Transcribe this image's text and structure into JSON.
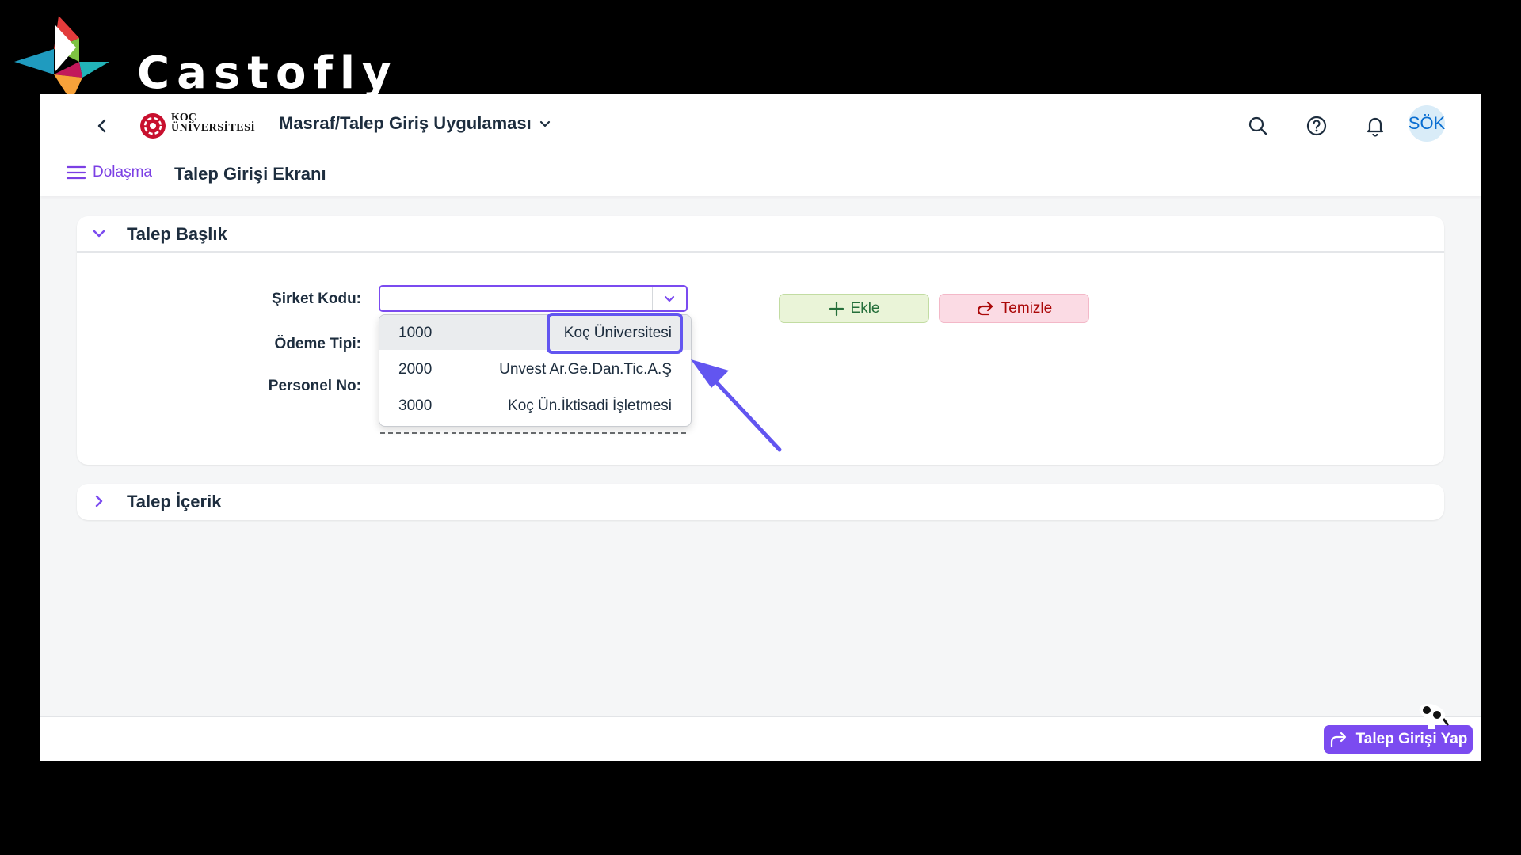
{
  "watermark": {
    "text": "Castofly"
  },
  "shell": {
    "logo_line1": "KOÇ",
    "logo_line2": "ÜNİVERSİTESİ",
    "app_title": "Masraf/Talep Giriş Uygulaması",
    "avatar_initials": "SÖK",
    "icons": [
      "back-icon",
      "search-icon",
      "help-icon",
      "bell-icon"
    ]
  },
  "subheader": {
    "nav_label": "Dolaşma",
    "page_title": "Talep Girişi Ekranı"
  },
  "header_panel": {
    "title": "Talep Başlık",
    "labels": {
      "company_code": "Şirket Kodu:",
      "payment_type": "Ödeme Tipi:",
      "personnel_no": "Personel No:"
    },
    "company_code_value": "",
    "add_label": "Ekle",
    "clear_label": "Temizle"
  },
  "dropdown": {
    "options": [
      {
        "code": "1000",
        "name": "Koç Üniversitesi",
        "selected": true
      },
      {
        "code": "2000",
        "name": "Unvest Ar.Ge.Dan.Tic.A.Ş",
        "selected": false
      },
      {
        "code": "3000",
        "name": "Koç Ün.İktisadi İşletmesi",
        "selected": false
      }
    ]
  },
  "content_panel": {
    "title": "Talep İçerik"
  },
  "footer": {
    "submit_label": "Talep Girişi Yap"
  },
  "colors": {
    "accent": "#7b4bf0",
    "highlight": "#6255f0",
    "add_bg": "#eaf4d8",
    "clear_bg": "#fbdbe4"
  }
}
